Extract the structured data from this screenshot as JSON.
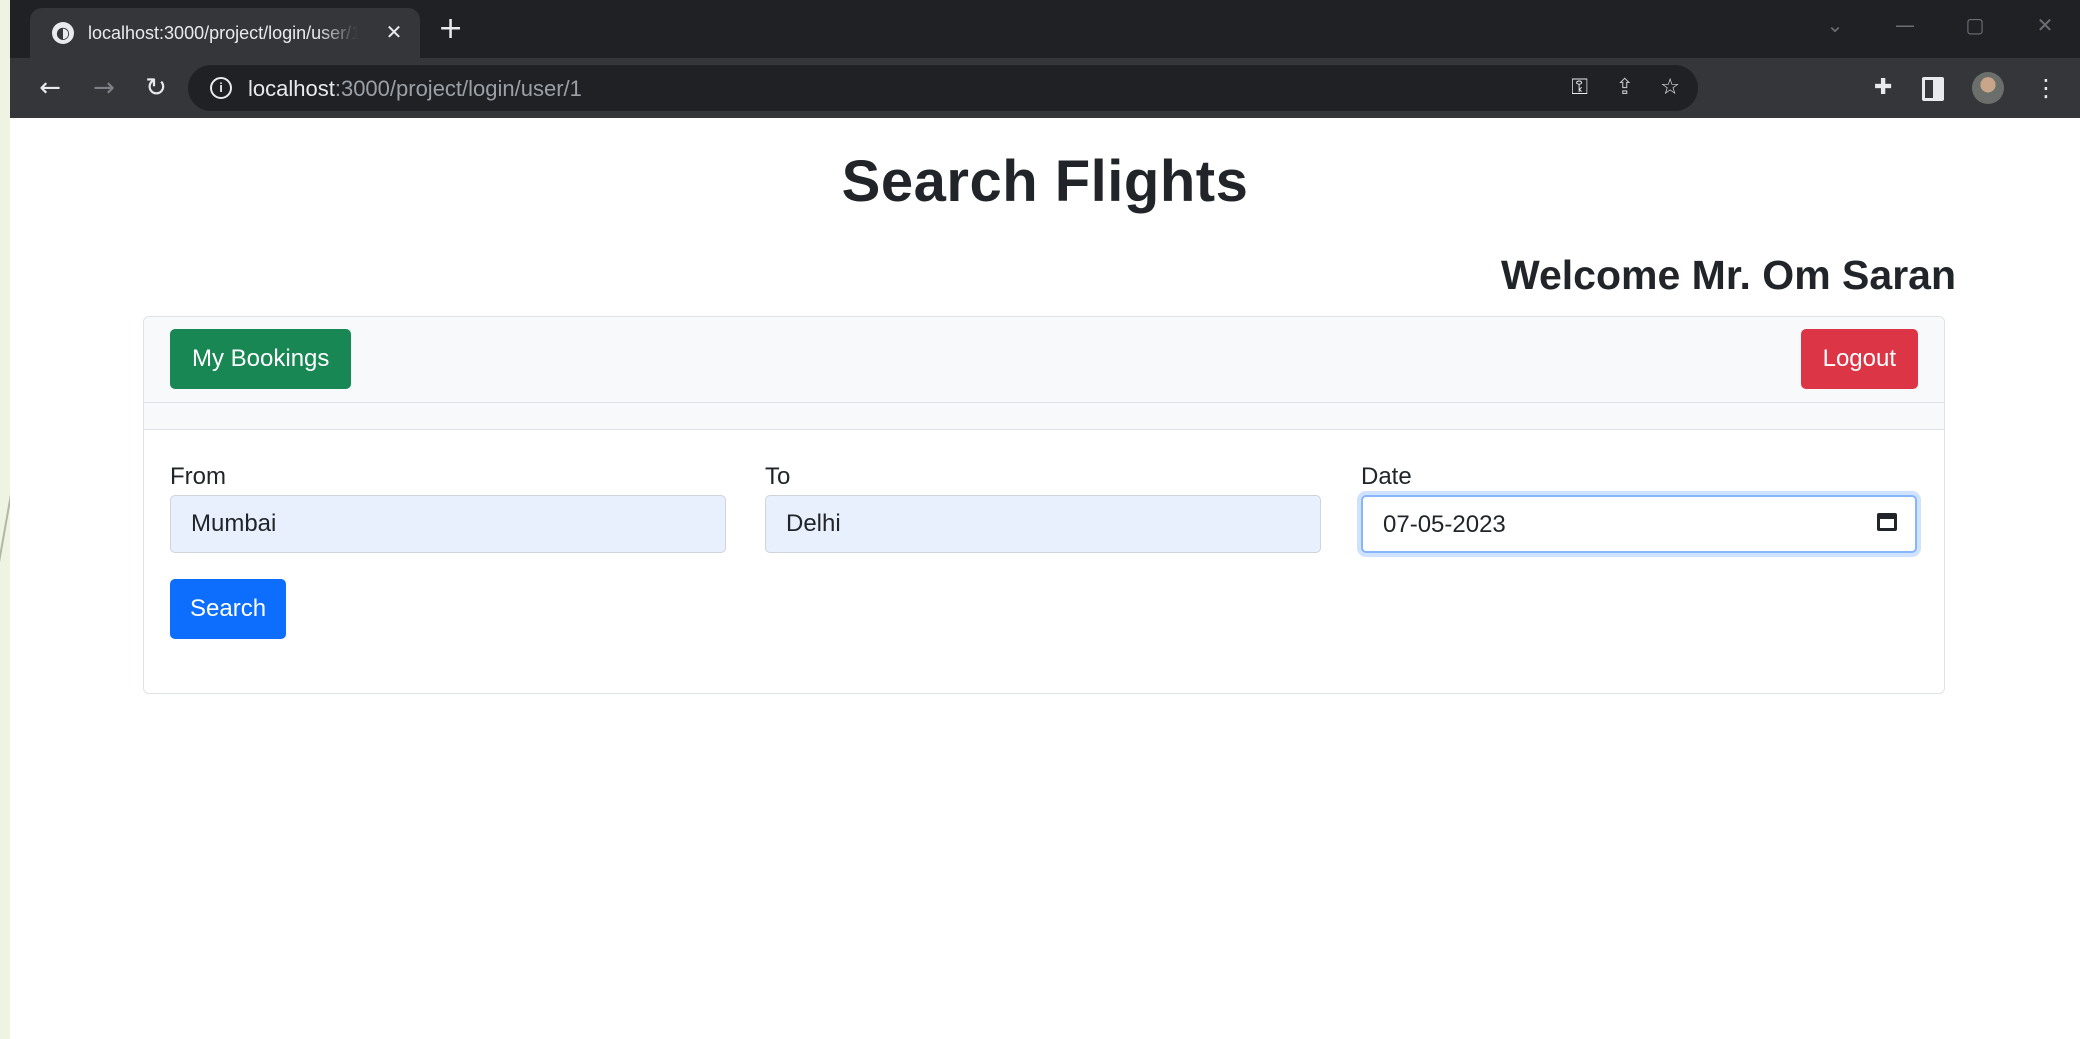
{
  "browser": {
    "tab_title": "localhost:3000/project/login/user/1",
    "tab_close": "✕",
    "new_tab": "+",
    "url_host": "localhost",
    "url_rest": ":3000/project/login/user/1",
    "icons": [
      "globe-icon",
      "back-icon",
      "forward-icon",
      "reload-icon",
      "info-icon",
      "key-icon",
      "share-icon",
      "star-icon",
      "extensions-icon",
      "side-panel-icon",
      "avatar",
      "menu-icon"
    ]
  },
  "page": {
    "title": "Search Flights",
    "welcome": "Welcome Mr. Om Saran"
  },
  "header": {
    "bookings_label": "My Bookings",
    "logout_label": "Logout"
  },
  "form": {
    "from_label": "From",
    "from_value": "Mumbai",
    "to_label": "To",
    "to_value": "Delhi",
    "date_label": "Date",
    "date_value": "07-05-2023",
    "search_label": "Search"
  },
  "colors": {
    "bookings_button": "#198754",
    "logout_button": "#dc3545",
    "search_button": "#0d6efd",
    "autofill_bg": "#e8f0fe"
  }
}
